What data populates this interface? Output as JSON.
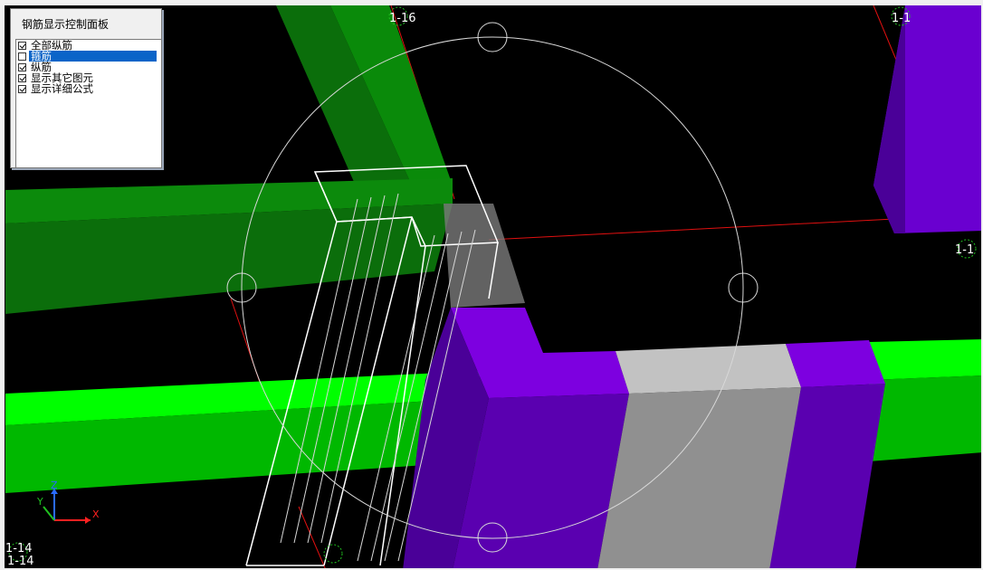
{
  "panel": {
    "title": "钢筋显示控制面板",
    "items": [
      {
        "label": "全部纵筋",
        "checked": true,
        "selected": false
      },
      {
        "label": "箍筋",
        "checked": false,
        "selected": true
      },
      {
        "label": "纵筋",
        "checked": true,
        "selected": false
      },
      {
        "label": "显示其它图元",
        "checked": true,
        "selected": false
      },
      {
        "label": "显示详细公式",
        "checked": true,
        "selected": false
      }
    ]
  },
  "viewport": {
    "grid_labels": [
      "1-16",
      "1-1",
      "1-1",
      "1-14",
      "1-14"
    ],
    "axes": {
      "x": "X",
      "y": "Y",
      "z": "Z"
    },
    "colors": {
      "background": "#000000",
      "dark_green_beam": "#0b6e0b",
      "bright_green_beam": "#00d800",
      "purple_column": "#6a00d0",
      "gray_column": "#9a9a9a",
      "grid_line": "#e01010",
      "rebar_wire": "#ffffff"
    }
  }
}
